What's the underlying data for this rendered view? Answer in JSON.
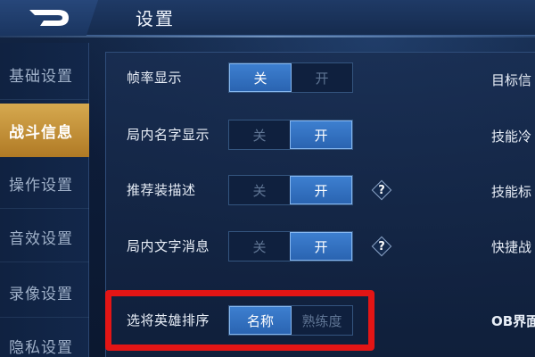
{
  "header": {
    "title": "设置"
  },
  "sidebar": {
    "items": [
      {
        "label": "基础设置",
        "active": false
      },
      {
        "label": "战斗信息",
        "active": true
      },
      {
        "label": "操作设置",
        "active": false
      },
      {
        "label": "音效设置",
        "active": false
      },
      {
        "label": "录像设置",
        "active": false
      },
      {
        "label": "隐私设置",
        "active": false
      }
    ]
  },
  "settings": {
    "frame_rate": {
      "label": "帧率显示",
      "off": "关",
      "on": "开",
      "selected": "off"
    },
    "name_display": {
      "label": "局内名字显示",
      "off": "关",
      "on": "开",
      "selected": "on"
    },
    "item_desc": {
      "label": "推荐装描述",
      "off": "关",
      "on": "开",
      "selected": "on",
      "help": "?"
    },
    "text_message": {
      "label": "局内文字消息",
      "off": "关",
      "on": "开",
      "selected": "on",
      "help": "?"
    },
    "hero_sort": {
      "label": "选将英雄排序",
      "opt1": "名称",
      "opt2": "熟练度",
      "selected": "opt1"
    }
  },
  "right_column": {
    "items": [
      "目标信",
      "技能冷",
      "技能标",
      "快捷战",
      "OB界面"
    ]
  },
  "colors": {
    "accent_active_tab": "#c8963a",
    "toggle_on": "#3573c4",
    "highlight_box": "#e31515"
  }
}
